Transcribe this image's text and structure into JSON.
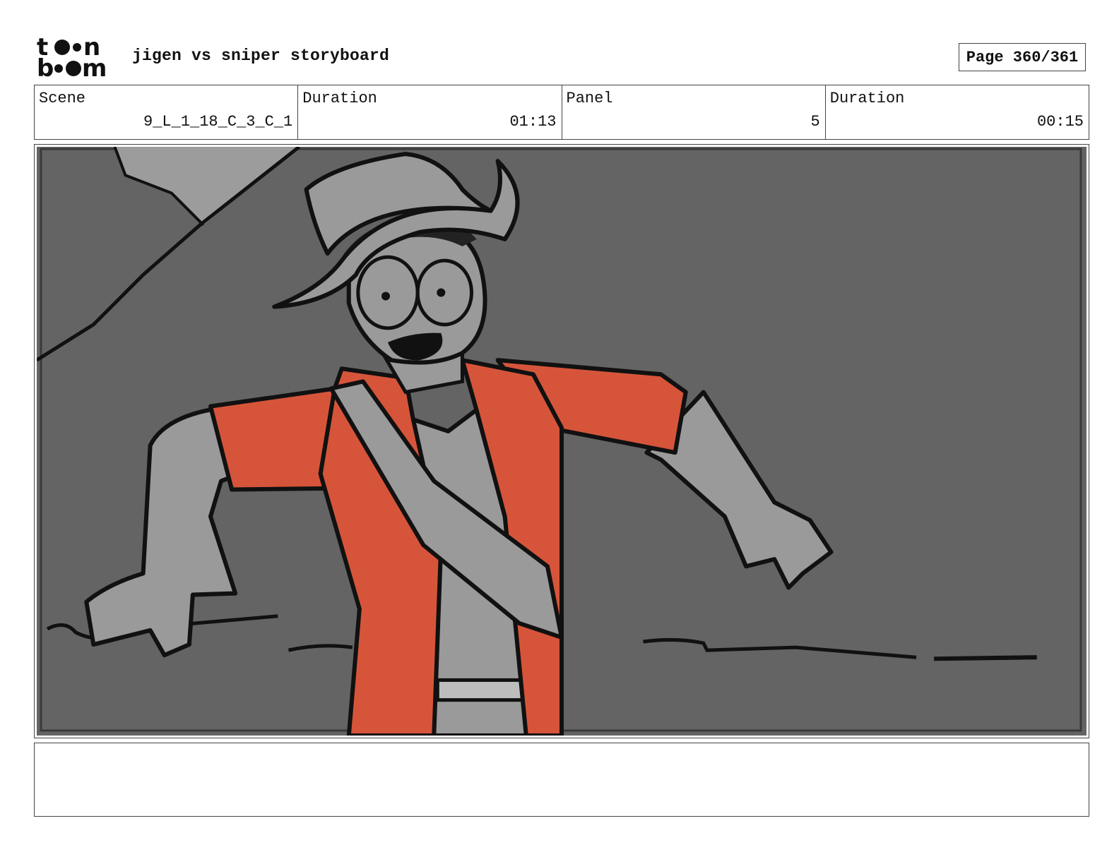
{
  "header": {
    "logo_text": "toon boom",
    "title": "jigen vs sniper storyboard",
    "page_label": "Page 360/361"
  },
  "info": {
    "scene_label": "Scene",
    "scene_value": "9_L_1_18_C_3_C_1",
    "scene_duration_label": "Duration",
    "scene_duration_value": "01:13",
    "panel_label": "Panel",
    "panel_value": "5",
    "panel_duration_label": "Duration",
    "panel_duration_value": "00:15"
  },
  "colors": {
    "background_grey": "#646464",
    "light_grey": "#9a9a9a",
    "jacket_orange": "#d6553a",
    "ink": "#111111"
  },
  "notes": {
    "text": ""
  }
}
